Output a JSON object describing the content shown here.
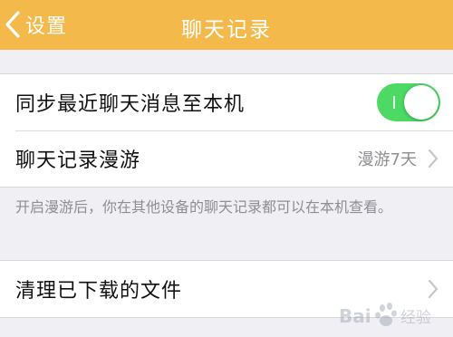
{
  "navbar": {
    "back_label": "设置",
    "title": "聊天记录",
    "background": "#f3b94a"
  },
  "settings": {
    "sync_label": "同步最近聊天消息至本机",
    "sync_enabled": true,
    "roaming_label": "聊天记录漫游",
    "roaming_value": "漫游7天",
    "roaming_description": "开启漫游后，你在其他设备的聊天记录都可以在本机查看。",
    "clear_downloads_label": "清理已下载的文件"
  },
  "icons": {
    "back": "chevron-left-icon",
    "disclosure": "chevron-right-icon"
  },
  "colors": {
    "toggle_on": "#4cd964",
    "background": "#efeff4"
  },
  "watermark": {
    "text": "Bai 经验"
  }
}
